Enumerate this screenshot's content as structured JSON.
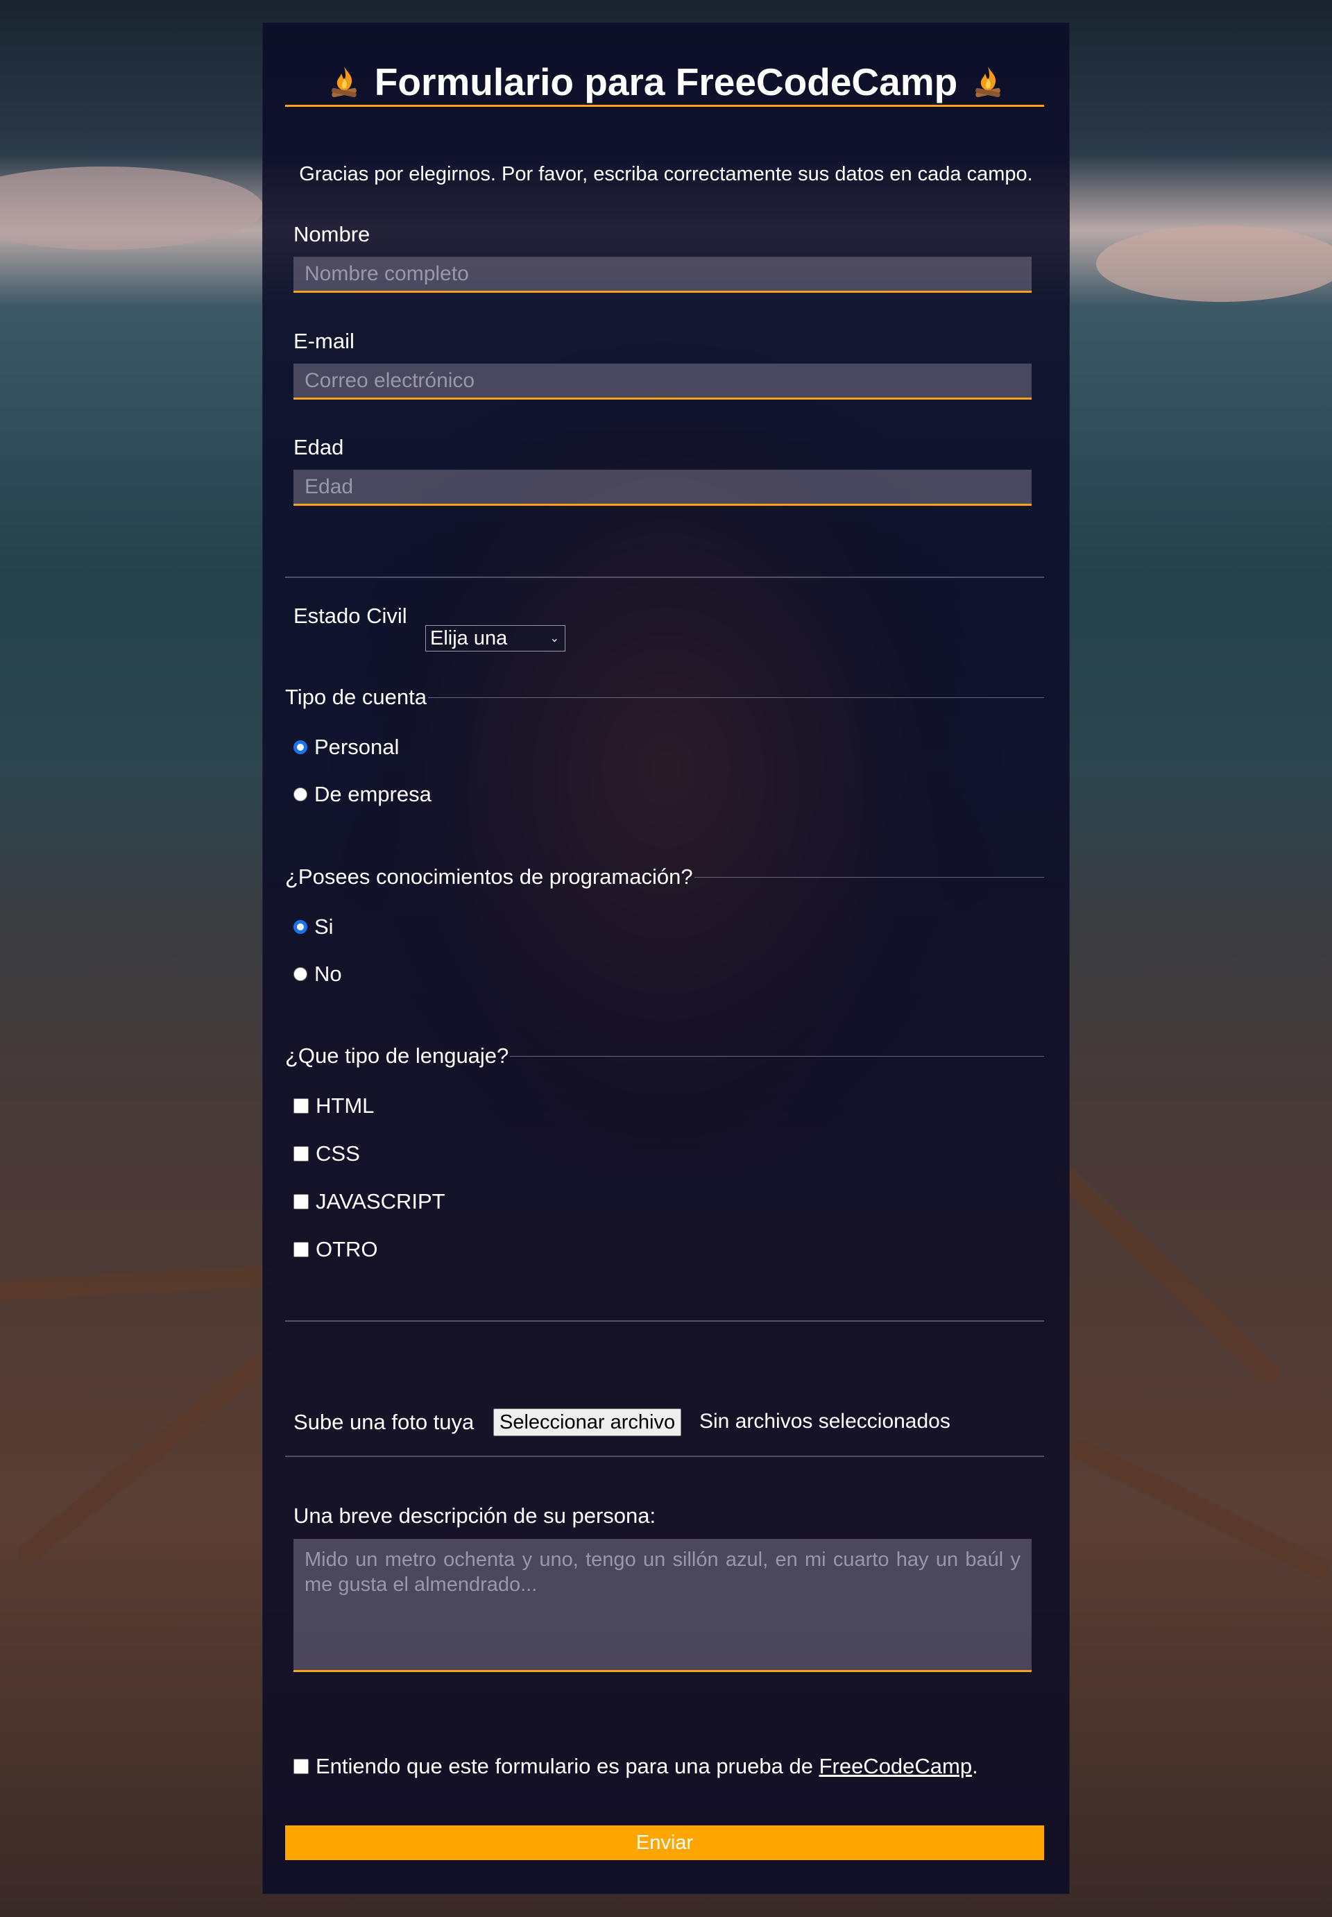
{
  "page": {
    "title": "Formulario para FreeCodeCamp",
    "lead": "Gracias por elegirnos. Por favor, escriba correctamente sus datos en cada campo."
  },
  "fields": {
    "name": {
      "label": "Nombre",
      "placeholder": "Nombre completo"
    },
    "email": {
      "label": "E-mail",
      "placeholder": "Correo electrónico"
    },
    "age": {
      "label": "Edad",
      "placeholder": "Edad"
    }
  },
  "civil": {
    "label": "Estado Civil",
    "selected": "Elija una"
  },
  "account": {
    "legend": "Tipo de cuenta",
    "options": [
      {
        "label": "Personal",
        "checked": true
      },
      {
        "label": "De empresa",
        "checked": false
      }
    ]
  },
  "programming": {
    "legend": "¿Posees conocimientos de programación?",
    "options": [
      {
        "label": "Si",
        "checked": true
      },
      {
        "label": "No",
        "checked": false
      }
    ]
  },
  "languages": {
    "legend": "¿Que tipo de lenguaje?",
    "options": [
      {
        "label": "HTML",
        "checked": false
      },
      {
        "label": "CSS",
        "checked": false
      },
      {
        "label": "JAVASCRIPT",
        "checked": false
      },
      {
        "label": "OTRO",
        "checked": false
      }
    ]
  },
  "upload": {
    "label": "Sube una foto tuya",
    "button": "Seleccionar archivo",
    "status": "Sin archivos seleccionados"
  },
  "description": {
    "label": "Una breve descripción de su persona:",
    "placeholder": "Mido un metro ochenta y uno, tengo un sillón azul, en mi cuarto hay un baúl y me gusta el almendrado..."
  },
  "agreement": {
    "text_before": "Entiendo que este formulario es para una prueba de ",
    "link": "FreeCodeCamp",
    "text_after": "."
  },
  "submit": {
    "label": "Enviar"
  },
  "colors": {
    "accent": "#f5a31a",
    "button": "#ffa500",
    "radio_selected": "#1a73e8"
  },
  "icons": {
    "title_icon": "campfire-icon"
  }
}
